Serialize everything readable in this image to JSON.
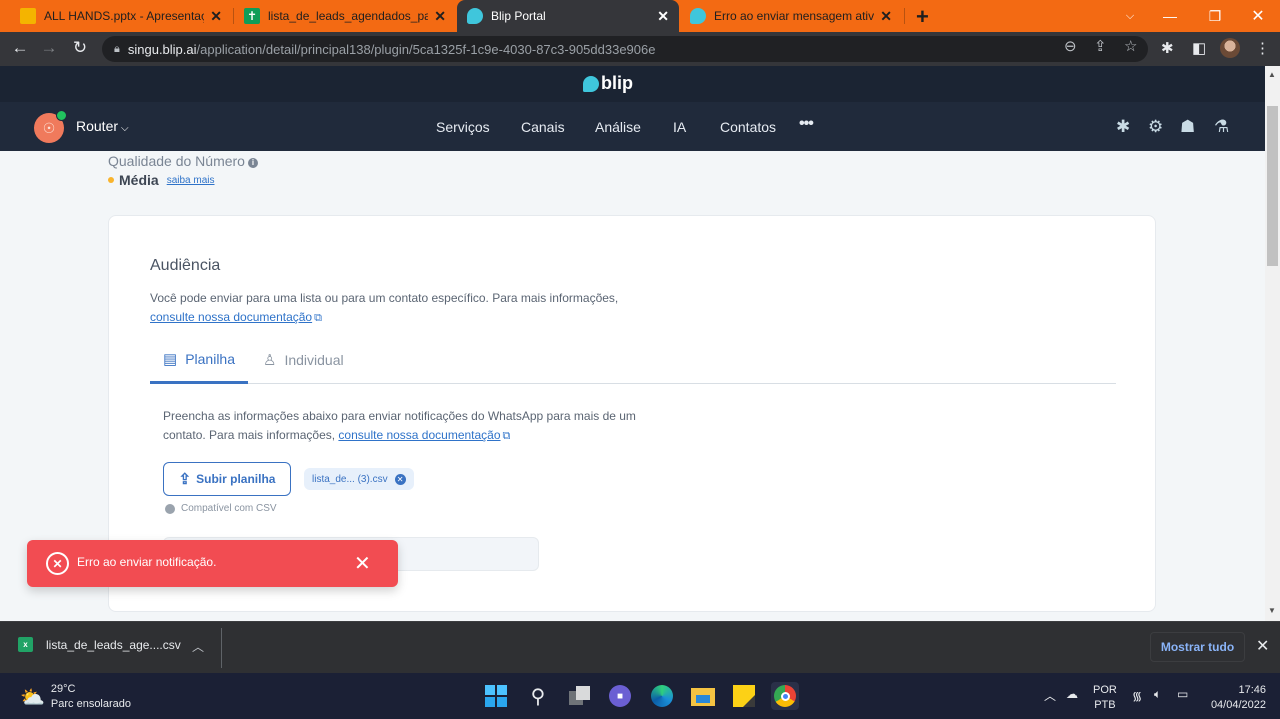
{
  "browser": {
    "tabs": [
      {
        "title": "ALL HANDS.pptx - Apresentações",
        "icon": "slides-icon",
        "active": false
      },
      {
        "title": "lista_de_leads_agendados_para_c",
        "icon": "sheets-icon",
        "active": false
      },
      {
        "title": "Blip Portal",
        "icon": "blip-icon",
        "active": true
      },
      {
        "title": "Erro ao enviar mensagem ativa -",
        "icon": "blip-icon",
        "active": false
      }
    ],
    "new_tab": "+",
    "url_host": "singu.blip.ai",
    "url_path": "/application/detail/principal138/plugin/5ca1325f-1c9e-4030-87c3-905dd33e906e"
  },
  "blip": {
    "logo_text": "blip",
    "bot_name": "Router",
    "nav": [
      "Serviços",
      "Canais",
      "Análise",
      "IA",
      "Contatos"
    ],
    "more": "•••"
  },
  "quality": {
    "label": "Qualidade do Número",
    "value": "Média",
    "link": "saiba mais",
    "status_color": "#f9b42d"
  },
  "audience": {
    "title": "Audiência",
    "desc": "Você pode enviar para uma lista ou para um contato específico. Para mais informações,",
    "doc_link": "consulte nossa documentação",
    "tabs": [
      {
        "label": "Planilha",
        "active": true
      },
      {
        "label": "Individual",
        "active": false
      }
    ],
    "sheet_desc": "Preencha as informações abaixo para enviar notificações do WhatsApp para mais de um contato. Para mais informações,",
    "sheet_doc_link": "consulte nossa documentação",
    "upload_label": "Subir planilha",
    "file_name": "lista_de... (3).csv",
    "compat": "Compatível com CSV"
  },
  "toast": {
    "message": "Erro ao enviar notificação.",
    "color": "#f24c52"
  },
  "downloads": {
    "file": "lista_de_leads_age....csv",
    "show_all": "Mostrar tudo"
  },
  "taskbar": {
    "temp": "29°C",
    "weather": "Parc ensolarado",
    "lang1": "POR",
    "lang2": "PTB",
    "time": "17:46",
    "date": "04/04/2022"
  }
}
